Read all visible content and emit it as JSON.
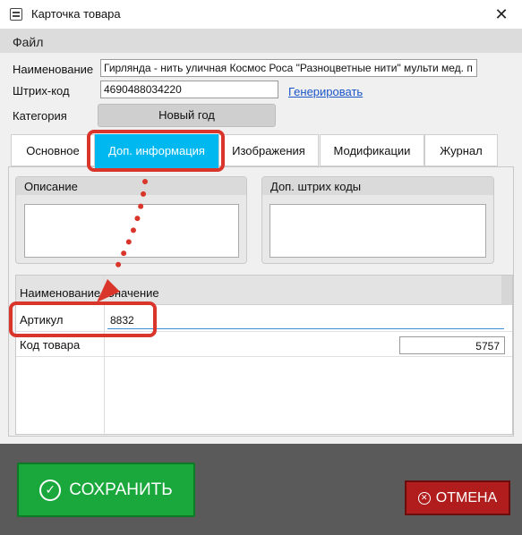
{
  "window": {
    "title": "Карточка товара",
    "close_glyph": "✕"
  },
  "menu": {
    "file": "Файл"
  },
  "form": {
    "name_label": "Наименование",
    "name_value": "Гирлянда - нить уличная Космос Роса \"Разноцветные  нити\"  мульти  мед. п",
    "barcode_label": "Штрих-код",
    "barcode_value": "4690488034220",
    "generate_link": "Генерировать",
    "category_label": "Категория",
    "category_value": "Новый год"
  },
  "tabs": [
    {
      "label": "Основное"
    },
    {
      "label": "Доп. информация"
    },
    {
      "label": "Изображения"
    },
    {
      "label": "Модификации"
    },
    {
      "label": "Журнал"
    }
  ],
  "groups": {
    "description": "Описание",
    "extra_barcodes": "Доп. штрих коды"
  },
  "grid": {
    "col_name": "Наименование",
    "col_value": "Значение",
    "rows": [
      {
        "name": "Артикул",
        "value": "8832"
      },
      {
        "name": "Код товара",
        "value": "5757"
      }
    ]
  },
  "buttons": {
    "save": "СОХРАНИТЬ",
    "cancel": "ОТМЕНА"
  },
  "icons": {
    "save": "check-circle-icon",
    "cancel": "x-circle-icon"
  },
  "colors": {
    "active_tab": "#00b8f0",
    "save": "#1aa83c",
    "cancel": "#b11d1d",
    "annotation": "#d9352a"
  }
}
